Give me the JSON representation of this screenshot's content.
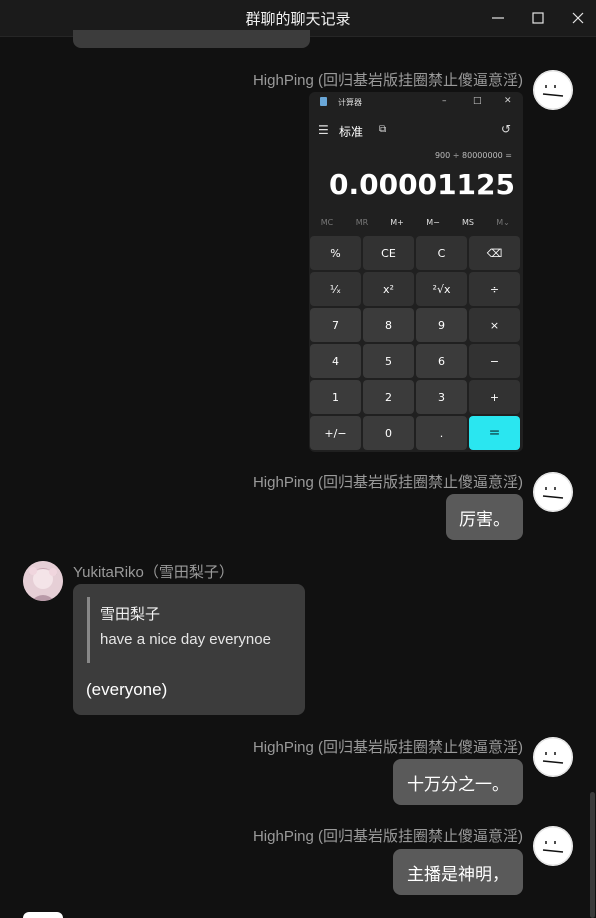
{
  "window": {
    "title": "群聊的聊天记录",
    "controls": [
      "minimize-icon",
      "maximize-icon",
      "close-icon"
    ]
  },
  "calculator": {
    "title": "计算器",
    "mode": "标准",
    "expression": "900 ÷ 80000000 =",
    "result": "0.00001125",
    "memory": [
      "MC",
      "MR",
      "M+",
      "M−",
      "MS",
      "M⌄"
    ],
    "keys": [
      [
        "%",
        "CE",
        "C",
        "⌫"
      ],
      [
        "¹⁄ₓ",
        "x²",
        "²√x",
        "÷"
      ],
      [
        "7",
        "8",
        "9",
        "×"
      ],
      [
        "4",
        "5",
        "6",
        "−"
      ],
      [
        "1",
        "2",
        "3",
        "+"
      ],
      [
        "+/−",
        "0",
        ".",
        "="
      ]
    ],
    "accent_color": "#2ae6f0"
  },
  "messages": {
    "m1": {
      "sender": "HighPing (回归基岩版挂圈禁止傻逼意淫)"
    },
    "m2": {
      "sender": "HighPing (回归基岩版挂圈禁止傻逼意淫)",
      "text": "厉害。"
    },
    "m3": {
      "sender": "YukitaRiko（雪田梨子）",
      "quote_author": "雪田梨子",
      "quote_text": "have a nice day everynoe",
      "text": "(everyone)"
    },
    "m4": {
      "sender": "HighPing (回归基岩版挂圈禁止傻逼意淫)",
      "text": "十万分之一。"
    },
    "m5": {
      "sender": "HighPing (回归基岩版挂圈禁止傻逼意淫)",
      "text": "主播是神明，"
    }
  },
  "colors": {
    "background": "#111111",
    "bubble": "#5a5a5a",
    "sender_text": "#9a9a9a"
  }
}
